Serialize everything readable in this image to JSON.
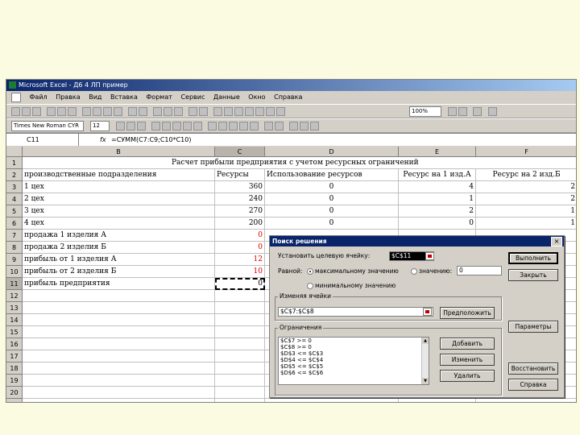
{
  "window": {
    "title": "Microsoft Excel - Д6 4 ЛП пример",
    "menu": [
      "Файл",
      "Правка",
      "Вид",
      "Вставка",
      "Формат",
      "Сервис",
      "Данные",
      "Окно",
      "Справка"
    ],
    "font_name": "Times New Roman CYR",
    "font_size": "12",
    "zoom": "100%"
  },
  "formula_bar": {
    "name_box": "C11",
    "fx": "fx",
    "formula": "=СУММ(C7:C9;C10*C10)"
  },
  "grid": {
    "columns": [
      "B",
      "C",
      "D",
      "E",
      "F"
    ],
    "row_numbers": [
      "1",
      "2",
      "3",
      "4",
      "5",
      "6",
      "7",
      "8",
      "9",
      "10",
      "11",
      "12",
      "13",
      "14",
      "15",
      "16",
      "17",
      "18",
      "19",
      "20",
      "21"
    ],
    "title_row": "Расчет прибыли предприятия с учетом ресурсных ограничений",
    "header": {
      "b": "производственные подразделения",
      "c": "Ресурсы",
      "d": "Использование ресурсов",
      "e": "Ресурс на 1 изд.А",
      "f": "Ресурс на 2 изд.Б"
    },
    "rows": [
      {
        "b": "1 цех",
        "c": "360",
        "d": "0",
        "e": "4",
        "f": "2"
      },
      {
        "b": "2 цех",
        "c": "240",
        "d": "0",
        "e": "1",
        "f": "2"
      },
      {
        "b": "3 цех",
        "c": "270",
        "d": "0",
        "e": "2",
        "f": "1"
      },
      {
        "b": "4 цех",
        "c": "200",
        "d": "0",
        "e": "0",
        "f": "1"
      },
      {
        "b": "продажа 1 изделия А",
        "c": "0"
      },
      {
        "b": "продажа 2 изделия Б",
        "c": "0"
      },
      {
        "b": "прибыль от 1 изделия А",
        "c": "12"
      },
      {
        "b": "прибыль от 2 изделия Б",
        "c": "10"
      },
      {
        "b": "прибыль предприятия",
        "c": "0"
      }
    ]
  },
  "solver": {
    "title": "Поиск решения",
    "close": "×",
    "target_label": "Установить целевую ячейку:",
    "target_value": "$C$11",
    "equal_label": "Равной:",
    "opt_max": "максимальному значению",
    "opt_value": "значению:",
    "value_field": "0",
    "opt_min": "минимальному значению",
    "changing_label": "Изменяя ячейки",
    "changing_value": "$C$7:$C$8",
    "guess_button": "Предположить",
    "constraints_label": "Ограничения",
    "constraints": [
      "$C$7 >= 0",
      "$C$8 >= 0",
      "$D$3 <= $C$3",
      "$D$4 <= $C$4",
      "$D$5 <= $C$5",
      "$D$6 <= $C$6"
    ],
    "buttons": {
      "solve": "Выполнить",
      "close": "Закрыть",
      "options": "Параметры",
      "add": "Добавить",
      "change": "Изменить",
      "delete": "Удалить",
      "reset": "Восстановить",
      "help": "Справка"
    }
  }
}
